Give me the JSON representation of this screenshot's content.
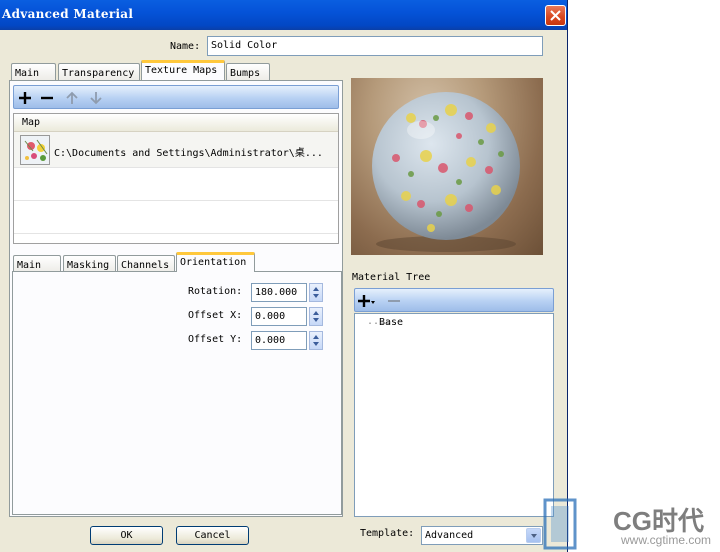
{
  "window": {
    "title": "Advanced Material"
  },
  "name_field": {
    "label": "Name:",
    "value": "Solid Color"
  },
  "top_tabs": [
    "Main",
    "Transparency",
    "Texture Maps",
    "Bumps"
  ],
  "map_list": {
    "header": "Map",
    "rows": [
      {
        "path": "C:\\Documents and Settings\\Administrator\\桌..."
      }
    ]
  },
  "bottom_tabs": [
    "Main",
    "Masking",
    "Channels",
    "Orientation"
  ],
  "orientation": {
    "rotation": {
      "label": "Rotation:",
      "value": "180.000"
    },
    "offset_x": {
      "label": "Offset X:",
      "value": "0.000"
    },
    "offset_y": {
      "label": "Offset Y:",
      "value": "0.000"
    }
  },
  "buttons": {
    "ok": "OK",
    "cancel": "Cancel"
  },
  "material_tree": {
    "label": "Material Tree",
    "items": [
      "Base"
    ]
  },
  "template": {
    "label": "Template:",
    "value": "Advanced"
  },
  "watermark": {
    "brand": "CG时代",
    "url": "www.cgtime.com"
  },
  "icons": {
    "add": "plus-icon",
    "remove": "minus-icon",
    "up": "arrow-up-icon",
    "down": "arrow-down-icon",
    "close": "close-icon"
  },
  "colors": {
    "titlebar": "#0553d8",
    "active_tab_accent": "#ffc83c",
    "dialog_bg": "#ece9d8"
  }
}
